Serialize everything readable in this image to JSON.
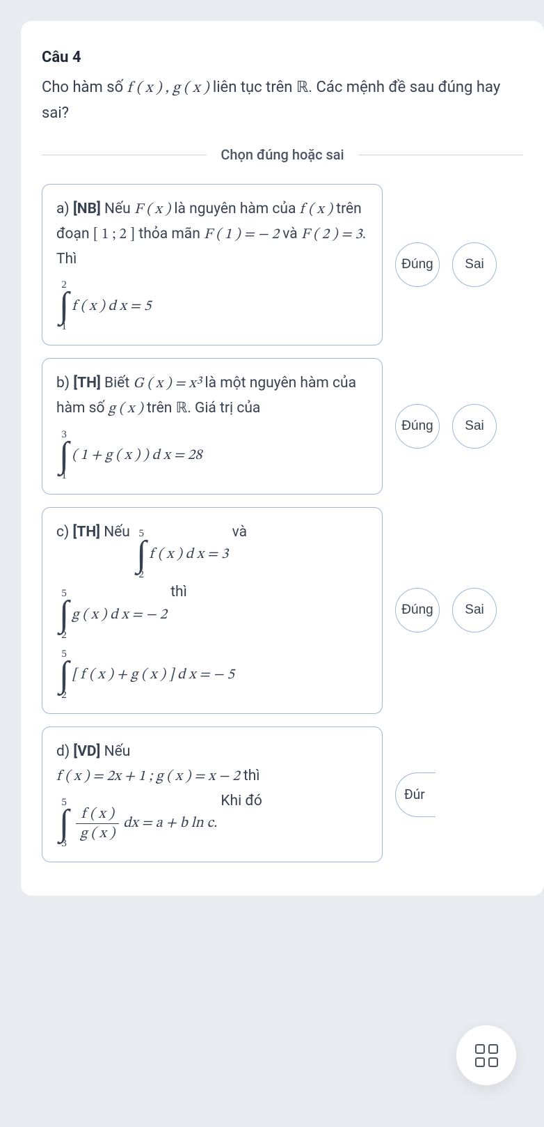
{
  "question": {
    "number_label": "Câu 4",
    "prompt_prefix": "Cho hàm số ",
    "prompt_fx": "f ( x ) , g ( x )",
    "prompt_mid": " liên tục trên ",
    "prompt_R": "ℝ",
    "prompt_suffix": ". Các mệnh đề sau đúng hay sai?"
  },
  "instruction": "Chọn đúng hoặc sai",
  "buttons": {
    "true": "Đúng",
    "false": "Sai",
    "true_partial": "Đúr"
  },
  "options": {
    "a": {
      "label": "a) ",
      "tag": "[NB]",
      "t1": " Nếu ",
      "Fx": "F ( x )",
      "t2": " là nguyên hàm của ",
      "fx": "f ( x )",
      "t3": " trên đoạn ",
      "interval": "[ 1 ; 2 ]",
      "t4": " thỏa mãn ",
      "F1": "F ( 1 ) = − 2",
      "and": " và ",
      "F2": "F ( 2 ) = 3",
      "t5": ". Thì",
      "int_up": "2",
      "int_lo": "1",
      "int_body": "f ( x ) d x = 5"
    },
    "b": {
      "label": "b) ",
      "tag": "[TH]",
      "t1": "  Biết ",
      "Gx": "G ( x ) = x³",
      "t2": " là một nguyên hàm của hàm số ",
      "gx": "g ( x )",
      "t3": " trên ",
      "R": "ℝ",
      "t4": ". Giá trị của ",
      "int_up": "3",
      "int_lo": "1",
      "int_body": "( 1 + g ( x ) ) d x = 28"
    },
    "c": {
      "label": "c) ",
      "tag": "[TH]",
      "t1": " Nếu ",
      "int1_up": "5",
      "int1_lo": "2",
      "int1_body": "f ( x ) d x = 3",
      "and": " và",
      "int2_up": "5",
      "int2_lo": "2",
      "int2_body": "g ( x ) d x = − 2",
      "t2": " thì",
      "int3_up": "5",
      "int3_lo": "2",
      "int3_body": "[ f ( x ) + g ( x ) ] d x = − 5"
    },
    "d": {
      "label": "d) ",
      "tag": "[VD]",
      "t1": " Nếu",
      "line2": "f ( x ) = 2x + 1 ;  g ( x ) = x − 2",
      "t2": " thì",
      "int_up": "5",
      "int_lo": "3",
      "frac_num": "f ( x )",
      "frac_den": "g ( x )",
      "after": " dx = a + b ln c.",
      "t3": " Khi đó"
    }
  }
}
